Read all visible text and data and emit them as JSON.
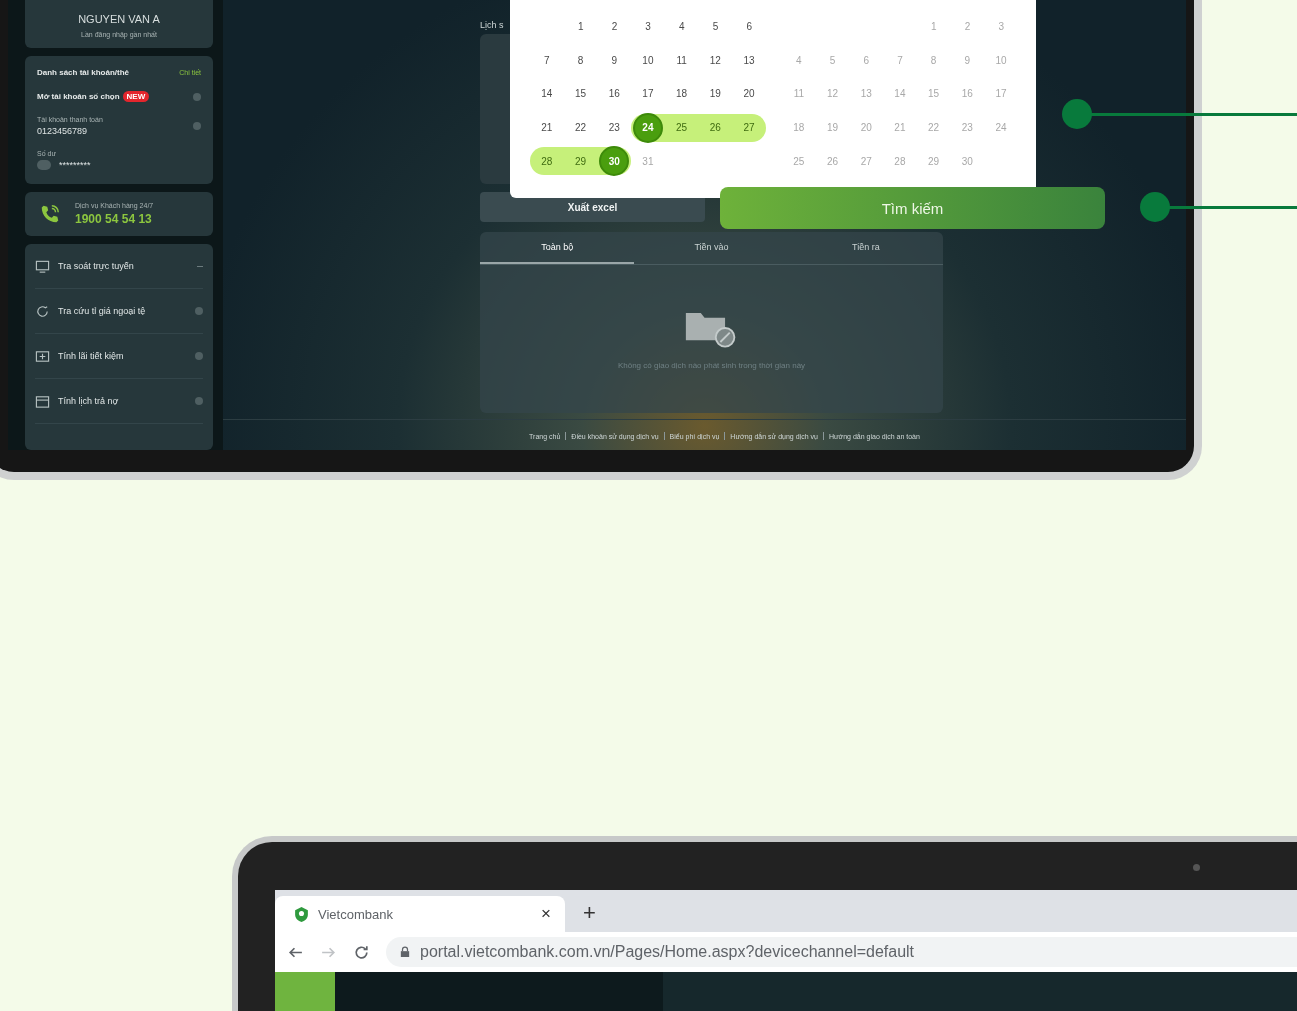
{
  "sidebar": {
    "user": {
      "name": "NGUYEN VAN A",
      "last_login_label": "Lần đăng nhập gần nhất"
    },
    "accounts": {
      "title": "Danh sách tài khoản/thẻ",
      "link": "Chi tiết",
      "open_account": "Mở tài khoản số chọn",
      "badge": "NEW",
      "account_label": "Tài khoản thanh toán",
      "account_number": "0123456789",
      "balance_label": "Số dư",
      "balance": "*********"
    },
    "hotline": {
      "label": "Dịch vụ Khách hàng 24/7",
      "number": "1900 54 54 13"
    },
    "menu": [
      {
        "label": "Tra soát trực tuyến",
        "kind": "monitor",
        "expandable": true
      },
      {
        "label": "Tra cứu tỉ giá ngoại tệ",
        "kind": "refresh",
        "expandable": false
      },
      {
        "label": "Tính lãi tiết kiệm",
        "kind": "calculator",
        "expandable": false
      },
      {
        "label": "Tính lịch trả nợ",
        "kind": "calendar",
        "expandable": false
      }
    ]
  },
  "main": {
    "history_label": "Lịch s",
    "export_button": "Xuất excel",
    "search_button": "Tìm kiếm",
    "tabs": [
      {
        "label": "Toàn bộ",
        "selected": true
      },
      {
        "label": "Tiền vào",
        "selected": false
      },
      {
        "label": "Tiền ra",
        "selected": false
      }
    ],
    "empty_message": "Không có giao dịch nào phát sinh trong thời gian này",
    "footer_links": [
      "Trang chủ",
      "Điều khoản sử dụng dịch vụ",
      "Biểu phí dịch vụ",
      "Hướng dẫn sử dụng dịch vụ",
      "Hướng dẫn giao dịch an toàn"
    ]
  },
  "calendar": {
    "months": [
      {
        "weeks": [
          [
            {
              "day": "1",
              "selected": false,
              "in_range": false,
              "disabled": false
            },
            {
              "day": "2",
              "selected": false,
              "in_range": false,
              "disabled": false
            },
            {
              "day": "3",
              "selected": false,
              "in_range": false,
              "disabled": false
            },
            {
              "day": "4",
              "selected": false,
              "in_range": false,
              "disabled": false
            },
            {
              "day": "5",
              "selected": false,
              "in_range": false,
              "disabled": false
            },
            {
              "day": "6",
              "selected": false,
              "in_range": false,
              "disabled": false
            }
          ],
          [
            {
              "day": "7",
              "selected": false,
              "in_range": false,
              "disabled": false
            },
            {
              "day": "8",
              "selected": false,
              "in_range": false,
              "disabled": false
            },
            {
              "day": "9",
              "selected": false,
              "in_range": false,
              "disabled": false
            },
            {
              "day": "10",
              "selected": false,
              "in_range": false,
              "disabled": false
            },
            {
              "day": "11",
              "selected": false,
              "in_range": false,
              "disabled": false
            },
            {
              "day": "12",
              "selected": false,
              "in_range": false,
              "disabled": false
            },
            {
              "day": "13",
              "selected": false,
              "in_range": false,
              "disabled": false
            }
          ],
          [
            {
              "day": "14",
              "selected": false,
              "in_range": false,
              "disabled": false
            },
            {
              "day": "15",
              "selected": false,
              "in_range": false,
              "disabled": false
            },
            {
              "day": "16",
              "selected": false,
              "in_range": false,
              "disabled": false
            },
            {
              "day": "17",
              "selected": false,
              "in_range": false,
              "disabled": false
            },
            {
              "day": "18",
              "selected": false,
              "in_range": false,
              "disabled": false
            },
            {
              "day": "19",
              "selected": false,
              "in_range": false,
              "disabled": false
            },
            {
              "day": "20",
              "selected": false,
              "in_range": false,
              "disabled": false
            }
          ],
          [
            {
              "day": "21",
              "selected": false,
              "in_range": false,
              "disabled": false
            },
            {
              "day": "22",
              "selected": false,
              "in_range": false,
              "disabled": false
            },
            {
              "day": "23",
              "selected": false,
              "in_range": false,
              "disabled": false
            },
            {
              "day": "24",
              "selected": true,
              "in_range": true,
              "disabled": false
            },
            {
              "day": "25",
              "selected": false,
              "in_range": true,
              "disabled": false
            },
            {
              "day": "26",
              "selected": false,
              "in_range": true,
              "disabled": false
            },
            {
              "day": "27",
              "selected": false,
              "in_range": true,
              "disabled": false
            }
          ],
          [
            {
              "day": "28",
              "selected": false,
              "in_range": true,
              "disabled": false
            },
            {
              "day": "29",
              "selected": false,
              "in_range": true,
              "disabled": false
            },
            {
              "day": "30",
              "selected": true,
              "in_range": true,
              "disabled": false
            },
            {
              "day": "31",
              "selected": false,
              "in_range": false,
              "disabled": true
            }
          ]
        ]
      },
      {
        "weeks": [
          [
            {
              "day": "1",
              "selected": false,
              "in_range": false,
              "disabled": true
            },
            {
              "day": "2",
              "selected": false,
              "in_range": false,
              "disabled": true
            },
            {
              "day": "3",
              "selected": false,
              "in_range": false,
              "disabled": true
            }
          ],
          [
            {
              "day": "4",
              "selected": false,
              "in_range": false,
              "disabled": true
            },
            {
              "day": "5",
              "selected": false,
              "in_range": false,
              "disabled": true
            },
            {
              "day": "6",
              "selected": false,
              "in_range": false,
              "disabled": true
            },
            {
              "day": "7",
              "selected": false,
              "in_range": false,
              "disabled": true
            },
            {
              "day": "8",
              "selected": false,
              "in_range": false,
              "disabled": true
            },
            {
              "day": "9",
              "selected": false,
              "in_range": false,
              "disabled": true
            },
            {
              "day": "10",
              "selected": false,
              "in_range": false,
              "disabled": true
            }
          ],
          [
            {
              "day": "11",
              "selected": false,
              "in_range": false,
              "disabled": true
            },
            {
              "day": "12",
              "selected": false,
              "in_range": false,
              "disabled": true
            },
            {
              "day": "13",
              "selected": false,
              "in_range": false,
              "disabled": true
            },
            {
              "day": "14",
              "selected": false,
              "in_range": false,
              "disabled": true
            },
            {
              "day": "15",
              "selected": false,
              "in_range": false,
              "disabled": true
            },
            {
              "day": "16",
              "selected": false,
              "in_range": false,
              "disabled": true
            },
            {
              "day": "17",
              "selected": false,
              "in_range": false,
              "disabled": true
            }
          ],
          [
            {
              "day": "18",
              "selected": false,
              "in_range": false,
              "disabled": true
            },
            {
              "day": "19",
              "selected": false,
              "in_range": false,
              "disabled": true
            },
            {
              "day": "20",
              "selected": false,
              "in_range": false,
              "disabled": true
            },
            {
              "day": "21",
              "selected": false,
              "in_range": false,
              "disabled": true
            },
            {
              "day": "22",
              "selected": false,
              "in_range": false,
              "disabled": true
            },
            {
              "day": "23",
              "selected": false,
              "in_range": false,
              "disabled": true
            },
            {
              "day": "24",
              "selected": false,
              "in_range": false,
              "disabled": true
            }
          ],
          [
            {
              "day": "25",
              "selected": false,
              "in_range": false,
              "disabled": true
            },
            {
              "day": "26",
              "selected": false,
              "in_range": false,
              "disabled": true
            },
            {
              "day": "27",
              "selected": false,
              "in_range": false,
              "disabled": true
            },
            {
              "day": "28",
              "selected": false,
              "in_range": false,
              "disabled": true
            },
            {
              "day": "29",
              "selected": false,
              "in_range": false,
              "disabled": true
            },
            {
              "day": "30",
              "selected": false,
              "in_range": false,
              "disabled": true
            }
          ]
        ]
      }
    ]
  },
  "browser": {
    "tab_title": "Vietcombank",
    "close": "×",
    "new_tab": "+",
    "url": "portal.vietcombank.com.vn/Pages/Home.aspx?devicechannel=default"
  }
}
